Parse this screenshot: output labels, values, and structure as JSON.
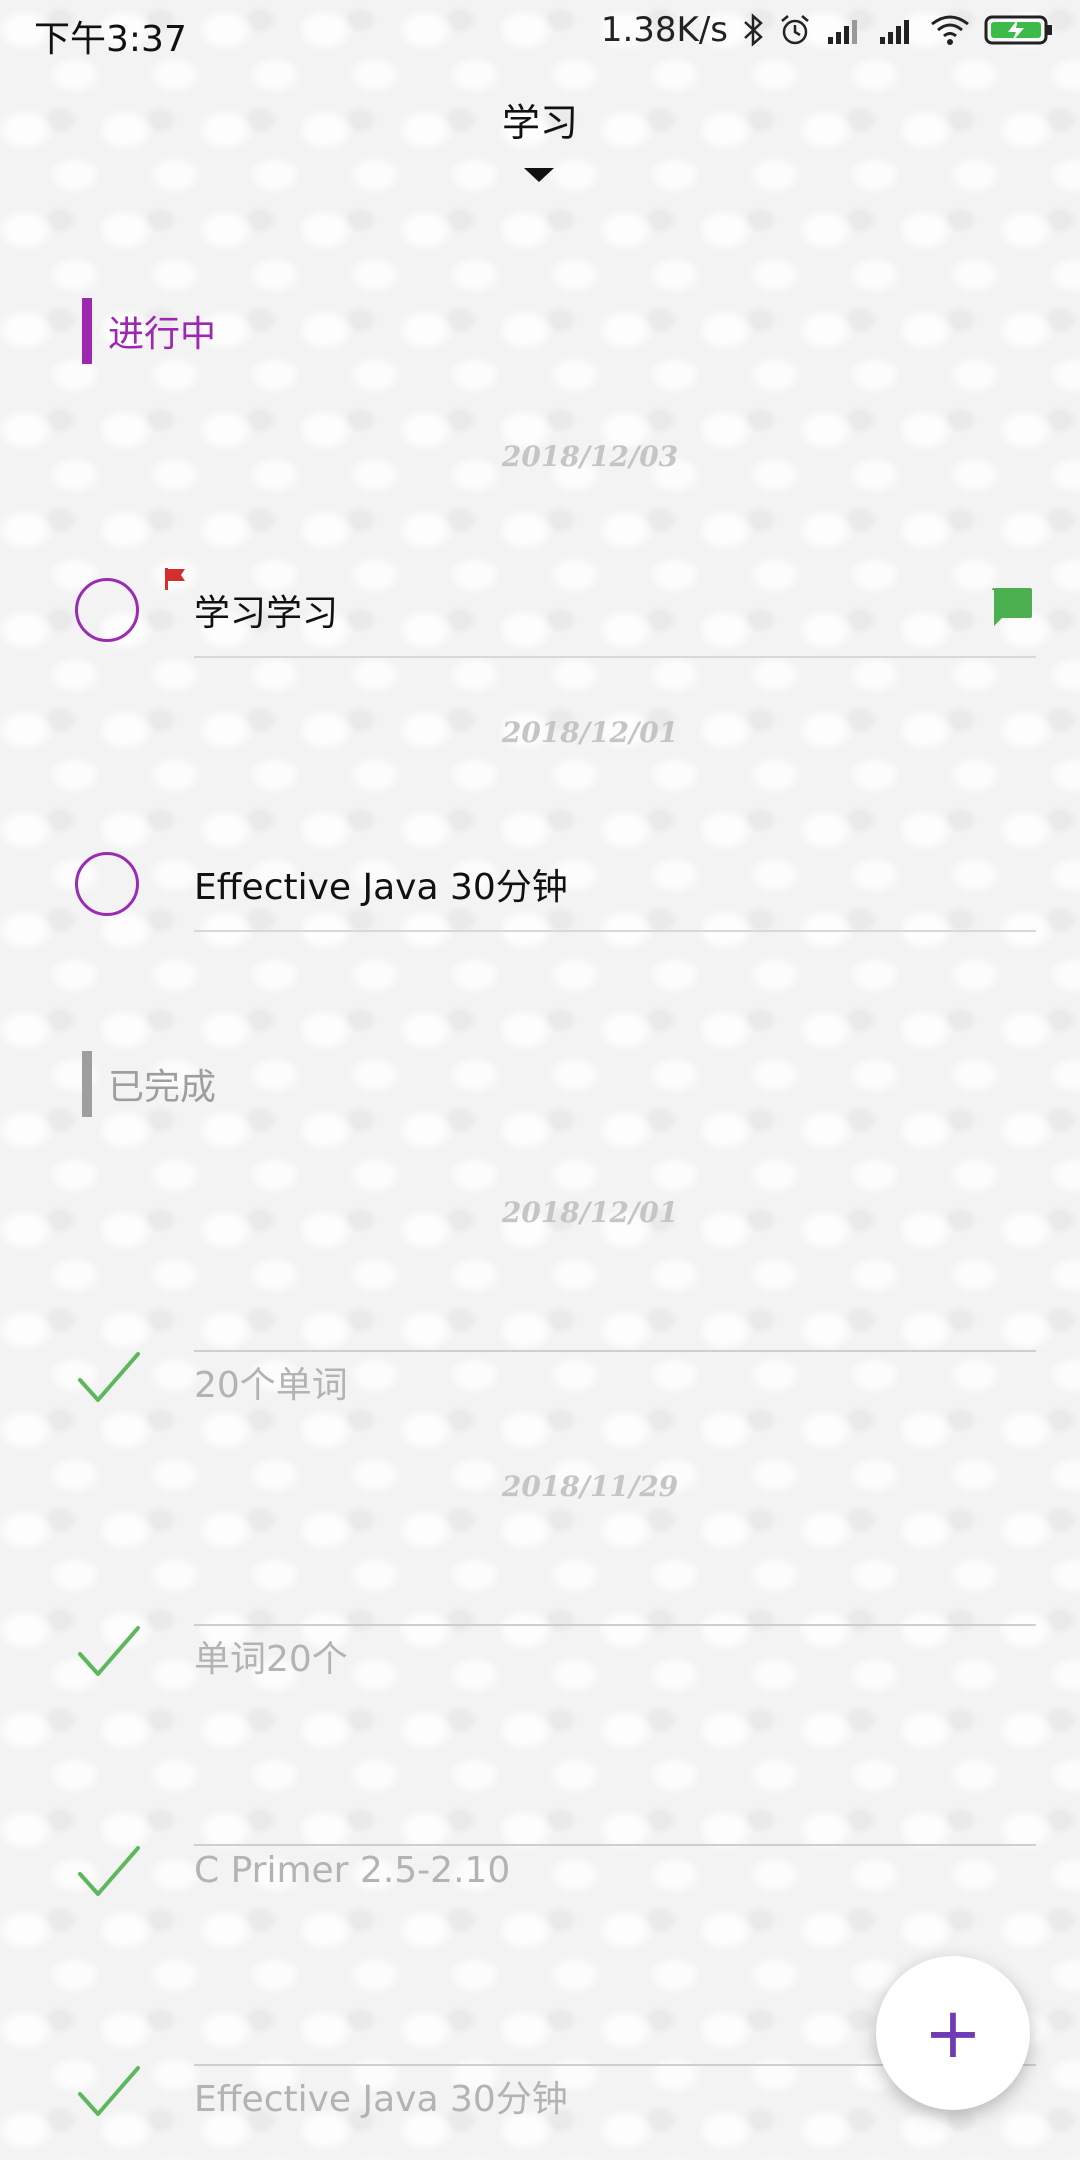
{
  "status_bar": {
    "time": "下午3:37",
    "net_speed": "1.38K/s",
    "icons": [
      "bluetooth-icon",
      "alarm-icon",
      "signal-icon",
      "signal-icon",
      "wifi-icon",
      "battery-charging-icon"
    ]
  },
  "header": {
    "title": "学习",
    "dropdown_icon": "caret-down-icon"
  },
  "sections": {
    "in_progress": {
      "label": "进行中",
      "color": "#9c27b0",
      "groups": [
        {
          "date": "2018/12/03",
          "tasks": [
            {
              "text": "学习学习",
              "flagged": true,
              "flag_color": "#d32f2f",
              "has_comment": true,
              "comment_color": "#4caf50"
            }
          ]
        },
        {
          "date": "2018/12/01",
          "tasks": [
            {
              "text": "Effective Java 30分钟"
            }
          ]
        }
      ]
    },
    "completed": {
      "label": "已完成",
      "color": "#9e9e9e",
      "groups": [
        {
          "date": "2018/12/01",
          "tasks": [
            {
              "text": "20个单词"
            }
          ]
        },
        {
          "date": "2018/11/29",
          "tasks": [
            {
              "text": "单词20个"
            },
            {
              "text": "C Primer 2.5-2.10"
            },
            {
              "text": "Effective Java 30分钟"
            }
          ]
        }
      ]
    }
  },
  "colors": {
    "accent": "#9c27b0",
    "check": "#5cb85c",
    "fab_icon": "#6e3bb5"
  },
  "fab": {
    "label": "+",
    "icon": "plus-icon"
  }
}
